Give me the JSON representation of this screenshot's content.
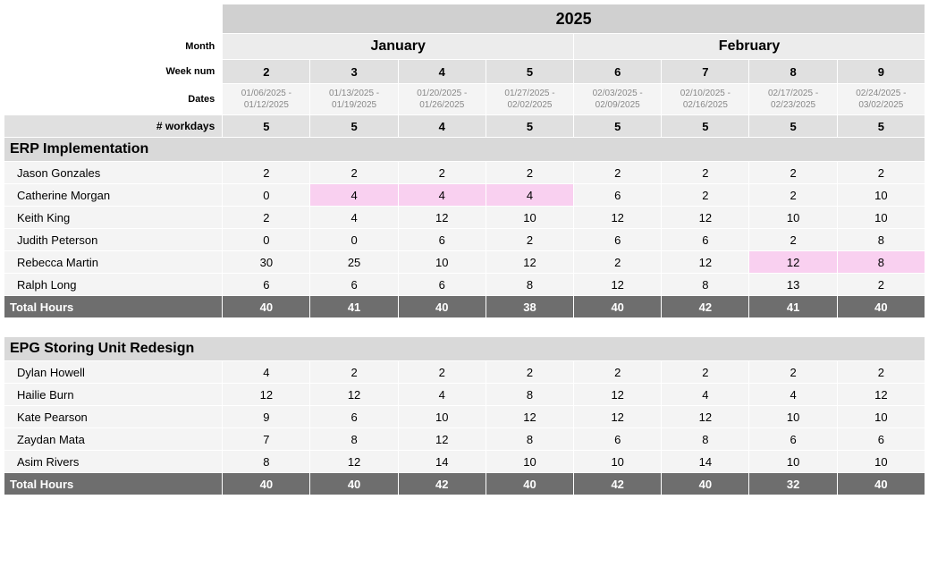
{
  "year": "2025",
  "header_labels": {
    "month": "Month",
    "week": "Week num",
    "dates": "Dates",
    "workdays": "# workdays"
  },
  "months": [
    {
      "name": "January",
      "span": 4
    },
    {
      "name": "February",
      "span": 4
    }
  ],
  "weeks": [
    "2",
    "3",
    "4",
    "5",
    "6",
    "7",
    "8",
    "9"
  ],
  "date_ranges": [
    "01/06/2025 - 01/12/2025",
    "01/13/2025 - 01/19/2025",
    "01/20/2025 - 01/26/2025",
    "01/27/2025 - 02/02/2025",
    "02/03/2025 - 02/09/2025",
    "02/10/2025 - 02/16/2025",
    "02/17/2025 - 02/23/2025",
    "02/24/2025 - 03/02/2025"
  ],
  "workdays": [
    "5",
    "5",
    "4",
    "5",
    "5",
    "5",
    "5",
    "5"
  ],
  "total_label": "Total Hours",
  "projects": [
    {
      "title": "ERP Implementation",
      "people": [
        {
          "name": "Jason Gonzales",
          "vals": [
            "2",
            "2",
            "2",
            "2",
            "2",
            "2",
            "2",
            "2"
          ],
          "hl": [
            0,
            0,
            0,
            0,
            0,
            0,
            0,
            0
          ]
        },
        {
          "name": "Catherine Morgan",
          "vals": [
            "0",
            "4",
            "4",
            "4",
            "6",
            "2",
            "2",
            "10"
          ],
          "hl": [
            0,
            1,
            1,
            1,
            0,
            0,
            0,
            0
          ]
        },
        {
          "name": "Keith King",
          "vals": [
            "2",
            "4",
            "12",
            "10",
            "12",
            "12",
            "10",
            "10"
          ],
          "hl": [
            0,
            0,
            0,
            0,
            0,
            0,
            0,
            0
          ]
        },
        {
          "name": "Judith Peterson",
          "vals": [
            "0",
            "0",
            "6",
            "2",
            "6",
            "6",
            "2",
            "8"
          ],
          "hl": [
            0,
            0,
            0,
            0,
            0,
            0,
            0,
            0
          ]
        },
        {
          "name": "Rebecca Martin",
          "vals": [
            "30",
            "25",
            "10",
            "12",
            "2",
            "12",
            "12",
            "8"
          ],
          "hl": [
            0,
            0,
            0,
            0,
            0,
            0,
            1,
            1
          ]
        },
        {
          "name": "Ralph Long",
          "vals": [
            "6",
            "6",
            "6",
            "8",
            "12",
            "8",
            "13",
            "2"
          ],
          "hl": [
            0,
            0,
            0,
            0,
            0,
            0,
            0,
            0
          ]
        }
      ],
      "totals": [
        "40",
        "41",
        "40",
        "38",
        "40",
        "42",
        "41",
        "40"
      ]
    },
    {
      "title": "EPG Storing Unit Redesign",
      "people": [
        {
          "name": "Dylan Howell",
          "vals": [
            "4",
            "2",
            "2",
            "2",
            "2",
            "2",
            "2",
            "2"
          ],
          "hl": [
            0,
            0,
            0,
            0,
            0,
            0,
            0,
            0
          ]
        },
        {
          "name": "Hailie Burn",
          "vals": [
            "12",
            "12",
            "4",
            "8",
            "12",
            "4",
            "4",
            "12"
          ],
          "hl": [
            0,
            0,
            0,
            0,
            0,
            0,
            0,
            0
          ]
        },
        {
          "name": "Kate Pearson",
          "vals": [
            "9",
            "6",
            "10",
            "12",
            "12",
            "12",
            "10",
            "10"
          ],
          "hl": [
            0,
            0,
            0,
            0,
            0,
            0,
            0,
            0
          ]
        },
        {
          "name": "Zaydan Mata",
          "vals": [
            "7",
            "8",
            "12",
            "8",
            "6",
            "8",
            "6",
            "6"
          ],
          "hl": [
            0,
            0,
            0,
            0,
            0,
            0,
            0,
            0
          ]
        },
        {
          "name": "Asim Rivers",
          "vals": [
            "8",
            "12",
            "14",
            "10",
            "10",
            "14",
            "10",
            "10"
          ],
          "hl": [
            0,
            0,
            0,
            0,
            0,
            0,
            0,
            0
          ]
        }
      ],
      "totals": [
        "40",
        "40",
        "42",
        "40",
        "42",
        "40",
        "32",
        "40"
      ]
    }
  ]
}
